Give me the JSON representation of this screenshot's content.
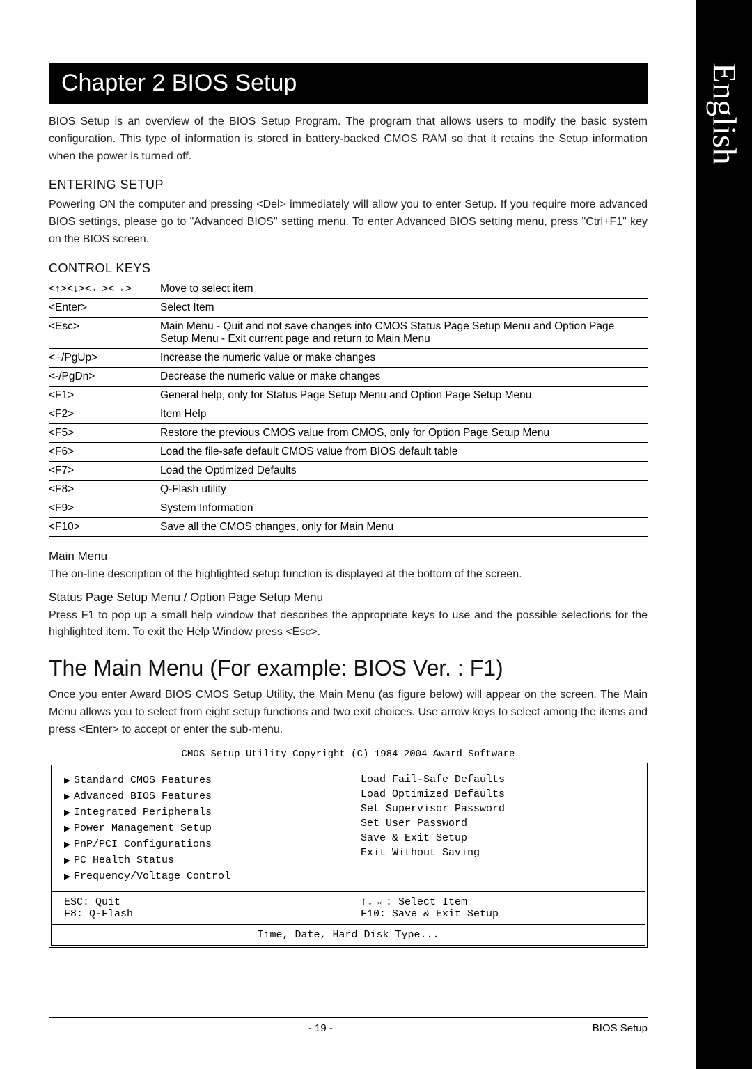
{
  "side_tab": "English",
  "chapter_title": "Chapter 2  BIOS Setup",
  "intro": "BIOS Setup is an overview of the BIOS Setup Program. The program that allows users to modify the basic system configuration. This type of information is stored in battery-backed CMOS RAM so that it retains the Setup information when the power is turned off.",
  "entering_head": "ENTERING SETUP",
  "entering_body": "Powering ON the computer and pressing <Del> immediately will allow you to enter Setup. If you require more advanced BIOS settings, please go to \"Advanced BIOS\" setting menu. To enter Advanced BIOS setting menu, press \"Ctrl+F1\" key on the BIOS screen.",
  "control_head": "CONTROL KEYS",
  "keys": [
    {
      "k": "<↑><↓><←><→>",
      "v": "Move to select item"
    },
    {
      "k": "<Enter>",
      "v": "Select Item"
    },
    {
      "k": "<Esc>",
      "v": "Main Menu - Quit and not save changes into CMOS Status Page Setup Menu and Option Page Setup Menu - Exit current page and return to Main Menu"
    },
    {
      "k": "<+/PgUp>",
      "v": "Increase the numeric value or make changes"
    },
    {
      "k": "<-/PgDn>",
      "v": "Decrease the numeric value or make changes"
    },
    {
      "k": "<F1>",
      "v": "General help, only for Status Page Setup Menu and Option Page Setup Menu"
    },
    {
      "k": "<F2>",
      "v": "Item Help"
    },
    {
      "k": "<F5>",
      "v": "Restore the previous CMOS value from CMOS, only for Option Page Setup Menu"
    },
    {
      "k": "<F6>",
      "v": "Load the file-safe default CMOS value from BIOS default table"
    },
    {
      "k": "<F7>",
      "v": "Load the Optimized Defaults"
    },
    {
      "k": "<F8>",
      "v": "Q-Flash utility"
    },
    {
      "k": "<F9>",
      "v": "System Information"
    },
    {
      "k": "<F10>",
      "v": "Save all the CMOS changes, only for Main Menu"
    }
  ],
  "main_menu_head": "Main Menu",
  "main_menu_body": "The on-line description of the highlighted setup function is displayed at the bottom of the screen.",
  "status_head": "Status Page Setup Menu / Option Page Setup Menu",
  "status_body": "Press F1 to pop up a small help window that describes the appropriate keys to use and the possible selections for the highlighted item. To exit the Help Window press <Esc>.",
  "h2": "The Main Menu (For example: BIOS Ver. : F1)",
  "h2_body": "Once you enter Award BIOS CMOS Setup Utility, the Main Menu (as figure below) will appear on the screen. The Main Menu allows you to select from eight setup functions and two exit choices. Use arrow keys to select among the items and press <Enter> to accept or enter the sub-menu.",
  "bios_caption": "CMOS Setup Utility-Copyright (C) 1984-2004 Award Software",
  "bios_left": [
    "Standard CMOS Features",
    "Advanced BIOS Features",
    "Integrated Peripherals",
    "Power Management Setup",
    "PnP/PCI Configurations",
    "PC Health Status",
    "Frequency/Voltage Control"
  ],
  "bios_right": [
    "Load Fail-Safe Defaults",
    "Load Optimized Defaults",
    "Set Supervisor Password",
    "Set User Password",
    "Save & Exit Setup",
    "Exit Without Saving"
  ],
  "bios_mid_left1": "ESC: Quit",
  "bios_mid_left2": "F8: Q-Flash",
  "bios_mid_right1": "↑↓→←: Select Item",
  "bios_mid_right2": "F10: Save & Exit Setup",
  "bios_bottom": "Time, Date, Hard Disk Type...",
  "footer_page": "- 19 -",
  "footer_right": "BIOS Setup"
}
